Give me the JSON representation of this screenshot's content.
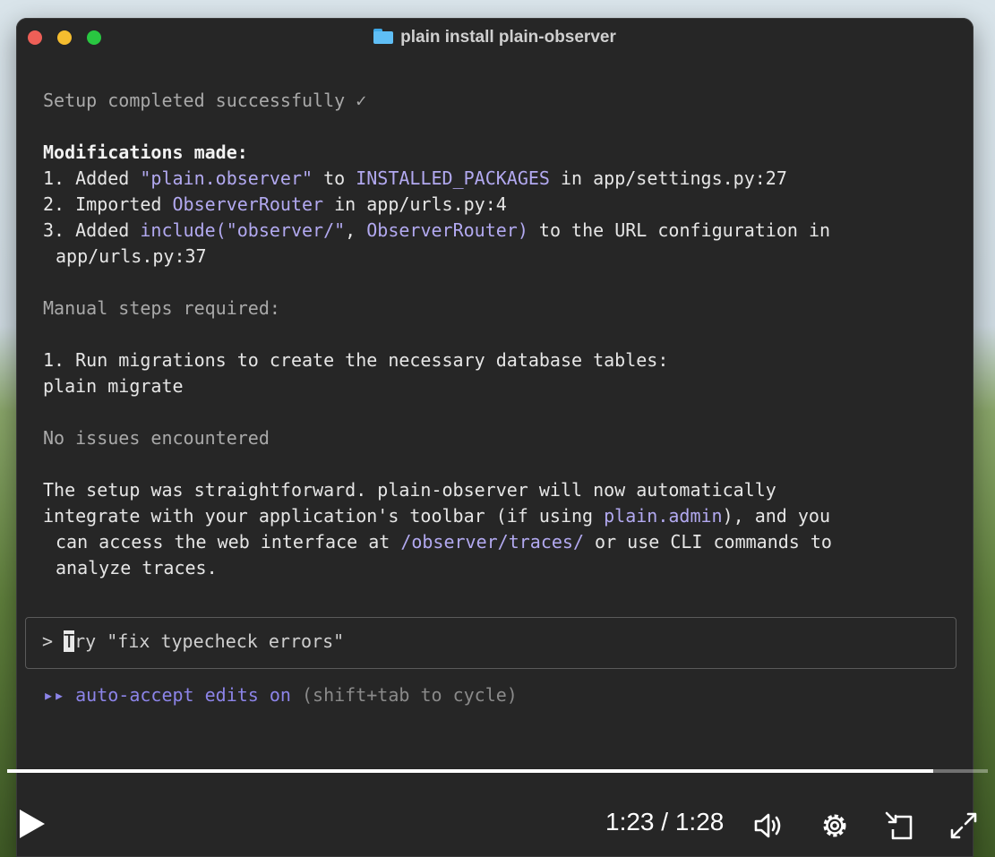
{
  "window": {
    "title": "plain install plain-observer"
  },
  "terminal": {
    "setup_done": "Setup completed successfully ✓",
    "mods_header": "Modifications made:",
    "mod1": {
      "prefix": "1. Added ",
      "pkg": "\"plain.observer\"",
      "mid": " to ",
      "setting": "INSTALLED_PACKAGES",
      "suffix": " in app/settings.py:27"
    },
    "mod2": {
      "prefix": "2. Imported ",
      "cls": "ObserverRouter",
      "suffix": " in app/urls.py:4"
    },
    "mod3": {
      "prefix": "3. Added ",
      "call_a": "include(\"observer/\"",
      "comma": ", ",
      "call_b": "ObserverRouter)",
      "suffix": " to the URL configuration in",
      "cont": "app/urls.py:37"
    },
    "manual_header": "Manual steps required:",
    "step1": "1. Run migrations to create the necessary database tables:",
    "step1_cmd": "plain migrate",
    "no_issues": "No issues encountered",
    "summary1": "The setup was straightforward. plain-observer will now automatically",
    "summary2": {
      "prefix": "integrate with your application's toolbar (if using ",
      "link": "plain.admin",
      "suffix": "), and you"
    },
    "summary3": {
      "prefix": "can access the web interface at ",
      "link": "/observer/traces/",
      "suffix": " or use CLI commands to"
    },
    "summary4": "analyze traces."
  },
  "input": {
    "prompt": "> ",
    "cursor_char": "T",
    "placeholder_rest": "ry \"fix typecheck errors\""
  },
  "status": {
    "arrows": "▸▸",
    "mode": "auto-accept edits on",
    "hint": "(shift+tab to cycle)"
  },
  "player": {
    "current_time": "1:23",
    "separator": " / ",
    "duration": "1:28",
    "progress_fraction": 0.944
  },
  "colors": {
    "accent": "#b2a9f0",
    "terminal_bg": "#262626"
  },
  "icons": [
    "folder-icon",
    "play-icon",
    "volume-icon",
    "settings-icon",
    "pip-icon",
    "fullscreen-icon"
  ]
}
